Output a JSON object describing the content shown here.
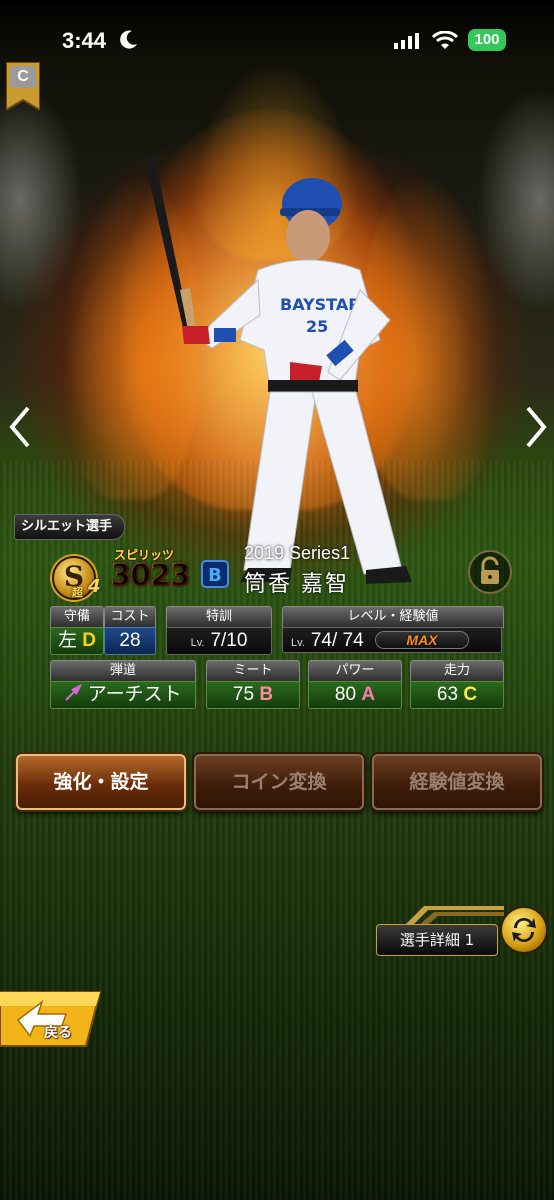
{
  "status_bar": {
    "time": "3:44",
    "battery": "100"
  },
  "rank_badge": {
    "letter": "C"
  },
  "silhouette_tag": "シルエット選手",
  "spirits": {
    "label": "スピリッツ",
    "value": "3023",
    "grade_letter": "S",
    "chou_label": "超",
    "chou_value": "4"
  },
  "player": {
    "series": "2019 Series1",
    "name": "筒香 嘉智"
  },
  "stats": {
    "defense": {
      "label": "守備",
      "value": "左",
      "grade": "D"
    },
    "cost": {
      "label": "コスト",
      "value": "28"
    },
    "training": {
      "label": "特訓",
      "lv_prefix": "Lv.",
      "value": "7/10"
    },
    "level": {
      "label": "レベル・経験値",
      "lv_prefix": "Lv.",
      "value": "74/ 74",
      "bar_text": "MAX",
      "exp_fraction": 1.0
    },
    "trajectory": {
      "label": "弾道",
      "value": "アーチスト"
    },
    "meet": {
      "label": "ミート",
      "value": "75",
      "grade": "B"
    },
    "power": {
      "label": "パワー",
      "value": "80",
      "grade": "A"
    },
    "speed": {
      "label": "走力",
      "value": "63",
      "grade": "C"
    }
  },
  "buttons": {
    "enhance": "強化・設定",
    "coin_exchange": "コイン変換",
    "exp_exchange": "経験値変換"
  },
  "detail": {
    "label": "選手詳細 1"
  },
  "back": {
    "label": "戻る"
  },
  "colors": {
    "button_border": "#e6c080",
    "stat_green": "#2a6a1e",
    "cost_blue": "#1f4a8a",
    "max_orange": "#ff8c1a"
  }
}
